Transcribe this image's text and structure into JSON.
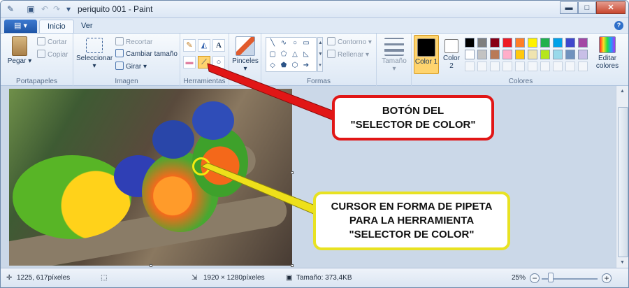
{
  "window": {
    "title": "periquito 001 - Paint",
    "buttons": {
      "minimize": "▬",
      "maximize": "□",
      "close": "✕"
    }
  },
  "tabs": {
    "file": "▤ ▾",
    "items": [
      "Inicio",
      "Ver"
    ],
    "help": "?"
  },
  "ribbon": {
    "clipboard": {
      "label": "Portapapeles",
      "paste": "Pegar",
      "cut": "Cortar",
      "copy": "Copiar"
    },
    "image": {
      "label": "Imagen",
      "select": "Seleccionar",
      "crop": "Recortar",
      "resize": "Cambiar tamaño",
      "rotate": "Girar ▾"
    },
    "tools": {
      "label": "Herramientas",
      "text_glyph": "A"
    },
    "shapes": {
      "label": "Formas",
      "outline": "Contorno ▾",
      "fill": "Rellenar ▾"
    },
    "brushes": {
      "label": "Pinceles"
    },
    "size": {
      "label": "Tamaño"
    },
    "colors": {
      "label": "Colores",
      "color1": "Color 1",
      "color2": "Color 2",
      "edit": "Editar colores",
      "palette_row1": [
        "#000000",
        "#7f7f7f",
        "#880015",
        "#ed1c24",
        "#ff7f27",
        "#fff200",
        "#22b14c",
        "#00a2e8",
        "#3f48cc",
        "#a349a4"
      ],
      "palette_row2": [
        "#ffffff",
        "#c3c3c3",
        "#b97a57",
        "#ffaec9",
        "#ffc90e",
        "#efe4b0",
        "#b5e61d",
        "#99d9ea",
        "#7092be",
        "#c8bfe7"
      ]
    }
  },
  "status": {
    "cursor_pos": "1225, 617píxeles",
    "image_size": "1920 × 1280píxeles",
    "file_size": "Tamaño: 373,4KB",
    "zoom": "25%"
  },
  "callouts": {
    "picker_button": [
      "BOTÓN DEL",
      "\"SELECTOR DE COLOR\""
    ],
    "picker_cursor": [
      "CURSOR EN FORMA DE PIPETA",
      "PARA LA HERRAMIENTA",
      "\"SELECTOR DE COLOR\""
    ]
  },
  "colors": {
    "red_callout": "#e11616",
    "yellow_callout": "#e8e222"
  }
}
